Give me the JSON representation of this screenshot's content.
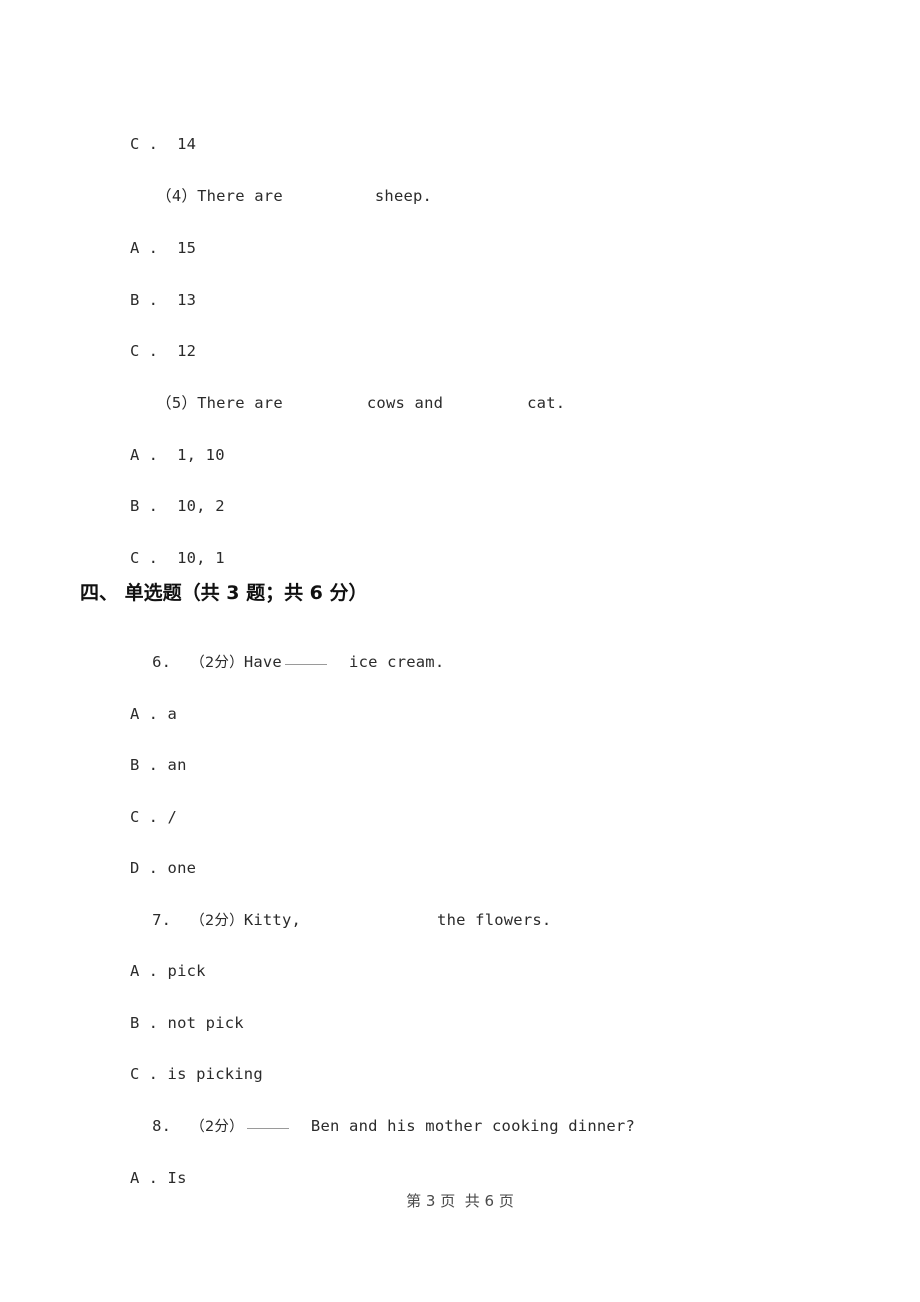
{
  "page": {
    "footer_text": "第 3 页  共 6 页",
    "page_number": "3",
    "total_pages": "6"
  },
  "carryover_block": {
    "trailing_option": {
      "label": "C .",
      "text": "14"
    },
    "questions": [
      {
        "number": "（4）",
        "stem_before": "There are",
        "stem_after": "sheep.",
        "options": [
          {
            "label": "A .",
            "text": "15"
          },
          {
            "label": "B .",
            "text": "13"
          },
          {
            "label": "C .",
            "text": "12"
          }
        ]
      },
      {
        "number": "（5）",
        "stem_before": "There are",
        "stem_middle": "cows and",
        "stem_after": "cat.",
        "options": [
          {
            "label": "A .",
            "text": "1, 10"
          },
          {
            "label": "B .",
            "text": "10, 2"
          },
          {
            "label": "C .",
            "text": "10, 1"
          }
        ]
      }
    ]
  },
  "section": {
    "heading": "四、 单选题（共 3 题；共 6 分）",
    "index_label": "四、",
    "title": "单选题",
    "meta": "（共 3 题；共 6 分）",
    "question_count": "3",
    "total_points": "6"
  },
  "questions": [
    {
      "number": "6.",
      "points": "（2分）",
      "stem_before": "Have",
      "stem_after": "ice cream.",
      "blank_style": "rule",
      "options": [
        {
          "label": "A .",
          "text": "a"
        },
        {
          "label": "B .",
          "text": "an"
        },
        {
          "label": "C .",
          "text": "/"
        },
        {
          "label": "D .",
          "text": "one"
        }
      ]
    },
    {
      "number": "7.",
      "points": "（2分）",
      "stem_before": "Kitty,",
      "stem_after": "the flowers.",
      "blank_style": "gap",
      "options": [
        {
          "label": "A .",
          "text": "pick"
        },
        {
          "label": "B .",
          "text": "not pick"
        },
        {
          "label": "C .",
          "text": "is picking"
        }
      ]
    },
    {
      "number": "8.",
      "points": "（2分）",
      "stem_before": "",
      "stem_after": "Ben and his mother cooking dinner?",
      "blank_style": "rule",
      "options": [
        {
          "label": "A .",
          "text": "Is"
        }
      ]
    }
  ]
}
